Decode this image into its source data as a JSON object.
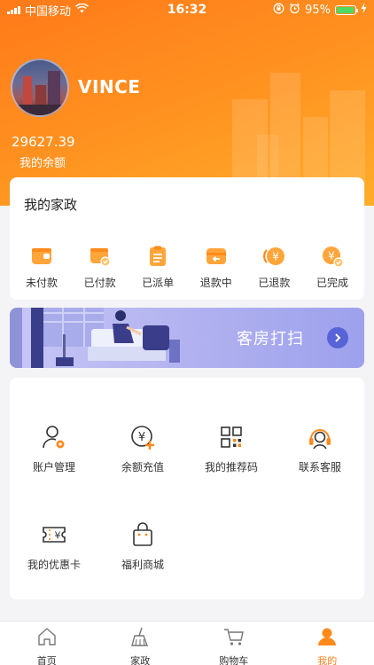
{
  "status_bar": {
    "carrier": "中国移动",
    "time": "16:32",
    "battery": "95%",
    "battery_level": 0.95
  },
  "profile": {
    "username": "VINCE",
    "balance_value": "29627.39",
    "balance_label": "我的余额"
  },
  "service_card": {
    "title": "我的家政",
    "statuses": [
      {
        "label": "未付款",
        "icon": "wallet-icon"
      },
      {
        "label": "已付款",
        "icon": "wallet-paid-icon"
      },
      {
        "label": "已派单",
        "icon": "clipboard-icon"
      },
      {
        "label": "退款中",
        "icon": "refund-icon"
      },
      {
        "label": "已退款",
        "icon": "refunded-icon"
      },
      {
        "label": "已完成",
        "icon": "completed-icon"
      }
    ]
  },
  "banner": {
    "title": "客房打扫"
  },
  "tools": [
    {
      "label": "账户管理",
      "icon": "user-settings-icon"
    },
    {
      "label": "余额充值",
      "icon": "recharge-icon"
    },
    {
      "label": "我的推荐码",
      "icon": "qrcode-icon"
    },
    {
      "label": "联系客服",
      "icon": "headset-icon"
    },
    {
      "label": "我的优惠卡",
      "icon": "coupon-icon"
    },
    {
      "label": "福利商城",
      "icon": "shopping-bag-icon"
    }
  ],
  "tabbar": {
    "active": "我的",
    "items": [
      {
        "label": "首页",
        "icon": "home-icon"
      },
      {
        "label": "家政",
        "icon": "broom-icon"
      },
      {
        "label": "购物车",
        "icon": "cart-icon"
      },
      {
        "label": "我的",
        "icon": "profile-icon"
      }
    ]
  },
  "colors": {
    "accent": "#ff7f1c",
    "header_start": "#ff7a1a",
    "header_end": "#ffad2a",
    "banner_accent": "#5863d8",
    "battery_green": "#4cd964"
  }
}
